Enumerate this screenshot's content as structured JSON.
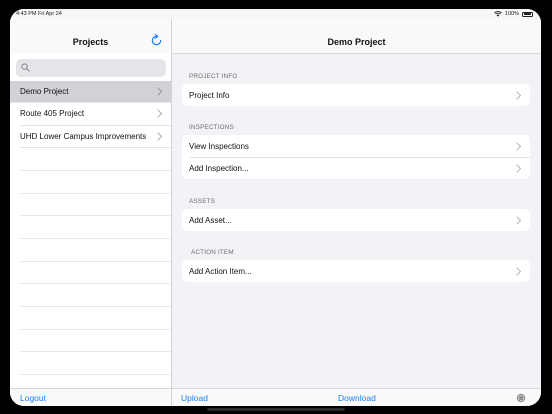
{
  "status_bar": {
    "time": "4:43 PM",
    "date": "Fri Apr 24",
    "battery": "100%"
  },
  "sidebar": {
    "title": "Projects",
    "search": {
      "placeholder": "",
      "value": ""
    },
    "projects": [
      {
        "label": "Demo Project",
        "selected": true
      },
      {
        "label": "Route 405 Project",
        "selected": false
      },
      {
        "label": "UHD Lower Campus Improvements",
        "selected": false
      }
    ],
    "footer": {
      "logout_label": "Logout"
    }
  },
  "detail": {
    "title": "Demo Project",
    "sections": {
      "project_info": {
        "header": "PROJECT INFO",
        "items": [
          "Project Info"
        ]
      },
      "inspections": {
        "header": "INSPECTIONS",
        "items": [
          "View Inspections",
          "Add Inspection..."
        ]
      },
      "assets": {
        "header": "ASSETS",
        "items": [
          "Add Asset..."
        ]
      },
      "action_item": {
        "header": "ACTION ITEM",
        "items": [
          "Add Action Item..."
        ]
      }
    },
    "footer": {
      "upload_label": "Upload",
      "download_label": "Download"
    }
  },
  "colors": {
    "accent": "#1a7ff0",
    "selected_row": "#d1d1d6",
    "background": "#f2f2f7"
  },
  "icons": [
    "refresh-icon",
    "search-icon",
    "chevron-right-icon",
    "wifi-icon",
    "battery-icon",
    "activity-spinner-icon"
  ]
}
